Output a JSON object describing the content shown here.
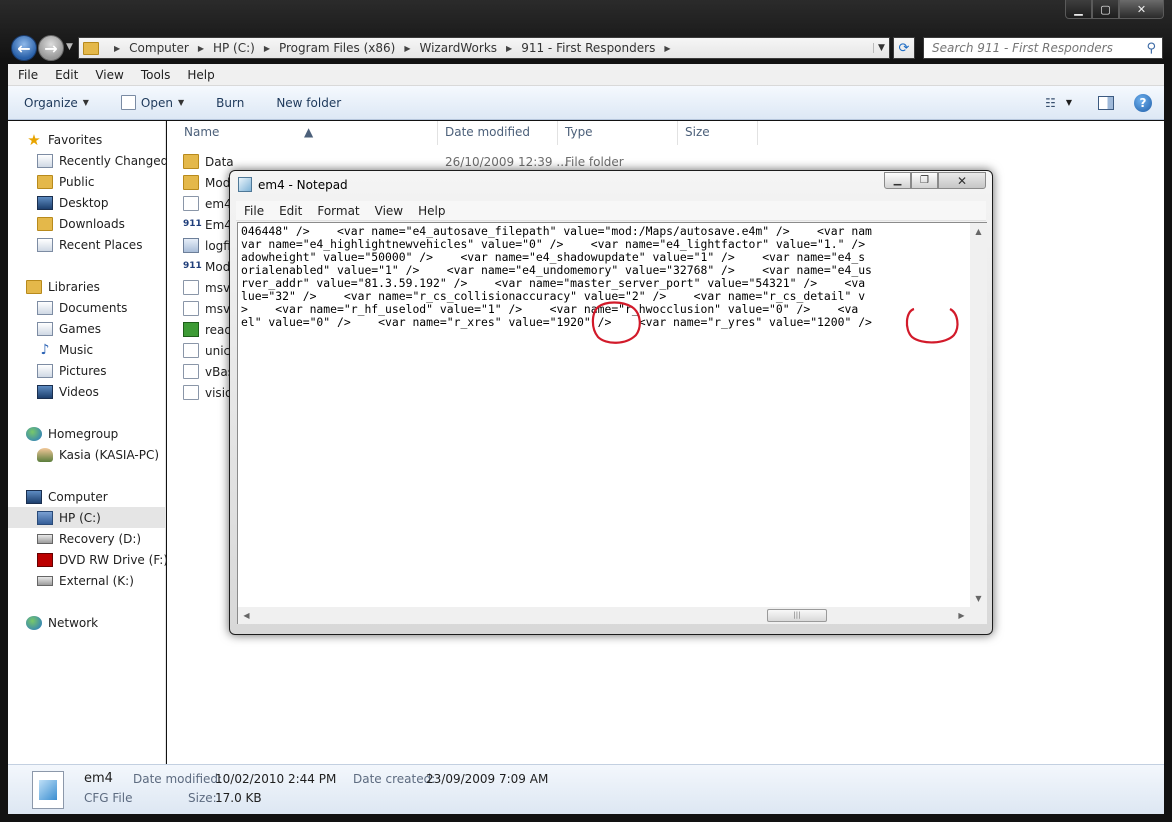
{
  "explorer": {
    "breadcrumb": [
      "Computer",
      "HP (C:)",
      "Program Files (x86)",
      "WizardWorks",
      "911 - First Responders"
    ],
    "search_placeholder": "Search 911 - First Responders",
    "menu": [
      "File",
      "Edit",
      "View",
      "Tools",
      "Help"
    ],
    "toolbar": {
      "organize": "Organize",
      "open": "Open",
      "burn": "Burn",
      "new_folder": "New folder"
    },
    "nav": {
      "favorites": "Favorites",
      "favorites_items": [
        "Recently Changed",
        "Public",
        "Desktop",
        "Downloads",
        "Recent Places"
      ],
      "libraries": "Libraries",
      "libraries_items": [
        "Documents",
        "Games",
        "Music",
        "Pictures",
        "Videos"
      ],
      "homegroup": "Homegroup",
      "homegroup_items": [
        "Kasia (KASIA-PC)"
      ],
      "computer": "Computer",
      "computer_items": [
        "HP (C:)",
        "Recovery (D:)",
        "DVD RW Drive (F:) C",
        "External (K:)"
      ],
      "network": "Network"
    },
    "columns": {
      "name": "Name",
      "date": "Date modified",
      "type": "Type",
      "size": "Size"
    },
    "files": [
      {
        "name": "Data",
        "date": "26/10/2009 12:39 ...",
        "type": "File folder"
      },
      {
        "name": "Mod",
        "date": "",
        "type": ""
      },
      {
        "name": "em4",
        "date": "",
        "type": ""
      },
      {
        "name": "Em4",
        "date": "",
        "type": ""
      },
      {
        "name": "logfi",
        "date": "",
        "type": ""
      },
      {
        "name": "Mod",
        "date": "",
        "type": ""
      },
      {
        "name": "msvc",
        "date": "",
        "type": ""
      },
      {
        "name": "msvc",
        "date": "",
        "type": ""
      },
      {
        "name": "readi",
        "date": "",
        "type": ""
      },
      {
        "name": "unic",
        "date": "",
        "type": ""
      },
      {
        "name": "vBas",
        "date": "",
        "type": ""
      },
      {
        "name": "visio",
        "date": "",
        "type": ""
      }
    ],
    "details": {
      "name": "em4",
      "type": "CFG File",
      "date_modified_label": "Date modified:",
      "date_modified": "10/02/2010 2:44 PM",
      "date_created_label": "Date created:",
      "date_created": "23/09/2009 7:09 AM",
      "size_label": "Size:",
      "size": "17.0 KB"
    }
  },
  "notepad": {
    "title": "em4 - Notepad",
    "menu": [
      "File",
      "Edit",
      "Format",
      "View",
      "Help"
    ],
    "lines": [
      "046448\" />    <var name=\"e4_autosave_filepath\" value=\"mod:/Maps/autosave.e4m\" />    <var nam",
      "var name=\"e4_highlightnewvehicles\" value=\"0\" />    <var name=\"e4_lightfactor\" value=\"1.\" />",
      "adowheight\" value=\"50000\" />    <var name=\"e4_shadowupdate\" value=\"1\" />    <var name=\"e4_s",
      "orialenabled\" value=\"1\" />    <var name=\"e4_undomemory\" value=\"32768\" />    <var name=\"e4_us",
      "rver_addr\" value=\"81.3.59.192\" />    <var name=\"master_server_port\" value=\"54321\" />    <va",
      "lue=\"32\" />    <var name=\"r_cs_collisionaccuracy\" value=\"2\" />    <var name=\"r_cs_detail\" v",
      ">    <var name=\"r_hf_uselod\" value=\"1\" />    <var name=\"r_hwocclusion\" value=\"0\" />    <va",
      "el\" value=\"0\" />    <var name=\"r_xres\" value=\"1920\" />    <var name=\"r_yres\" value=\"1200\" />"
    ]
  },
  "colors": {
    "annotation": "#d21a2a",
    "accent": "#1e395b"
  }
}
